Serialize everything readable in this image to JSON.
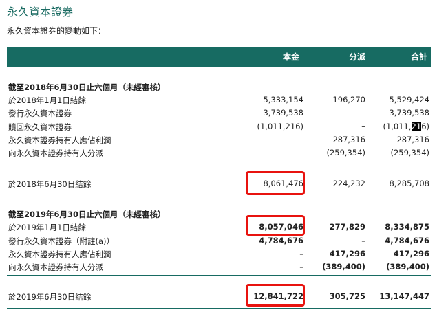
{
  "title": "永久資本證券",
  "subtitle": "永久資本證券的變動如下：",
  "columns": {
    "principal": "本金",
    "distribution": "分派",
    "total": "合計"
  },
  "period1": {
    "heading": "截至2018年6月30日止六個月（未經審核）",
    "rows": [
      {
        "label": "於2018年1月1日結餘",
        "principal": "5,333,154",
        "distribution": "196,270",
        "total": "5,529,424"
      },
      {
        "label": "發行永久資本證券",
        "principal": "3,739,538",
        "distribution": "–",
        "total": "3,739,538"
      },
      {
        "label": "贖回永久資本證券",
        "principal": "(1,011,216)",
        "distribution": "–",
        "total_pre": "(1,011,",
        "total_sel": "21",
        "total_post": "6)"
      },
      {
        "label": "永久資本證券持有人應佔利潤",
        "principal": "–",
        "distribution": "287,316",
        "total": "287,316"
      },
      {
        "label": "向永久資本證券持有人分派",
        "principal": "–",
        "distribution": "(259,354)",
        "total": "(259,354)"
      }
    ],
    "closing": {
      "label": "於2018年6月30日結餘",
      "principal": "8,061,476",
      "distribution": "224,232",
      "total": "8,285,708"
    }
  },
  "period2": {
    "heading": "截至2019年6月30日止六個月（未經審核）",
    "rows": [
      {
        "label": "於2019年1月1日結餘",
        "principal": "8,057,046",
        "distribution": "277,829",
        "total": "8,334,875"
      },
      {
        "label": "發行永久資本證券（附註(a)）",
        "principal": "4,784,676",
        "distribution": "–",
        "total": "4,784,676"
      },
      {
        "label": "永久資本證券持有人應佔利潤",
        "principal": "–",
        "distribution": "417,296",
        "total": "417,296"
      },
      {
        "label": "向永久資本證券持有人分派",
        "principal": "–",
        "distribution": "(389,400)",
        "total": "(389,400)"
      }
    ],
    "closing": {
      "label": "於2019年6月30日結餘",
      "principal": "12,841,722",
      "distribution": "305,725",
      "total": "13,147,447"
    }
  },
  "colors": {
    "header": "#176b62",
    "highlight": "#e8130f"
  }
}
